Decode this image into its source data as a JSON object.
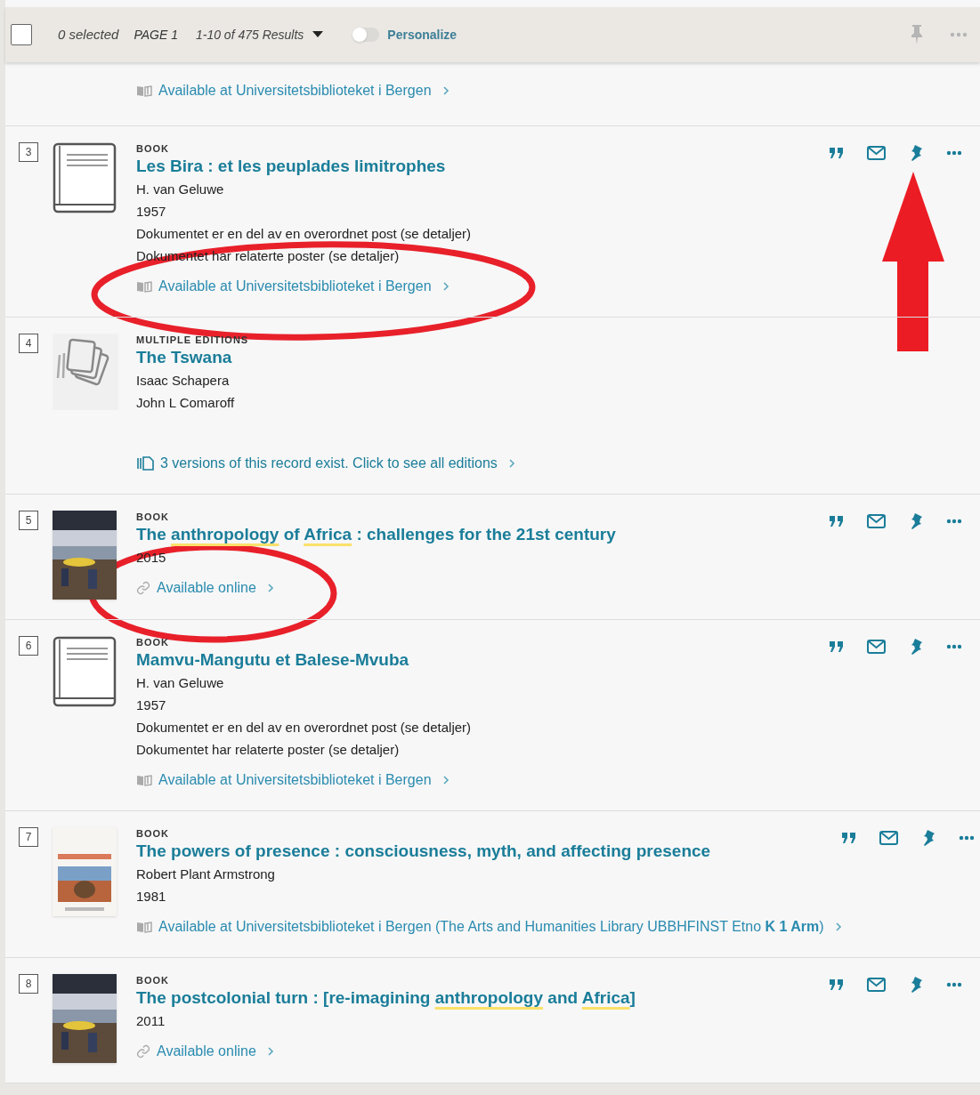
{
  "toolbar": {
    "select_all": {
      "checked": false
    },
    "selected_count": "0 selected",
    "page": "PAGE 1",
    "results": "1-10 of 475 Results",
    "personalize": {
      "label": "Personalize",
      "on": false
    }
  },
  "results": [
    {
      "kind": "partial",
      "availability": {
        "kind": "physical",
        "text": "Available at Universitetsbiblioteket i Bergen"
      }
    },
    {
      "kind": "record",
      "number": "3",
      "type": "BOOK",
      "thumbnail": {
        "kind": "book"
      },
      "actions": true,
      "title": [
        {
          "text": "Les Bira : et les peuplades limitrophes",
          "highlight": false
        }
      ],
      "lines": [
        "H. van Geluwe",
        "1957",
        "Dokumentet er en del av en overordnet post (se detaljer)",
        "Dokumentet har relaterte poster (se detaljer)"
      ],
      "availability": {
        "kind": "physical",
        "text": "Available at Universitetsbiblioteket i Bergen"
      }
    },
    {
      "kind": "record",
      "number": "4",
      "type": "MULTIPLE EDITIONS",
      "thumbnail": {
        "kind": "editions"
      },
      "actions": false,
      "title": [
        {
          "text": "The Tswana",
          "highlight": false
        }
      ],
      "lines": [
        "Isaac Schapera",
        "John L Comaroff"
      ],
      "availability": {
        "kind": "versions",
        "text": "3 versions of this record exist. Click to see all editions"
      }
    },
    {
      "kind": "record",
      "number": "5",
      "type": "BOOK",
      "thumbnail": {
        "kind": "picture"
      },
      "actions": true,
      "title": [
        {
          "text": "The ",
          "highlight": false
        },
        {
          "text": "anthropology",
          "highlight": true
        },
        {
          "text": " of ",
          "highlight": false
        },
        {
          "text": "Africa",
          "highlight": true
        },
        {
          "text": " : challenges for the 21st century",
          "highlight": false
        }
      ],
      "lines": [
        "2015"
      ],
      "availability": {
        "kind": "online",
        "text": "Available online"
      }
    },
    {
      "kind": "record",
      "number": "6",
      "type": "BOOK",
      "thumbnail": {
        "kind": "book"
      },
      "actions": true,
      "title": [
        {
          "text": "Mamvu-Mangutu et Balese-Mvuba",
          "highlight": false
        }
      ],
      "lines": [
        "H. van Geluwe",
        "1957",
        "Dokumentet er en del av en overordnet post (se detaljer)",
        "Dokumentet har relaterte poster (se detaljer)"
      ],
      "availability": {
        "kind": "physical",
        "text": "Available at Universitetsbiblioteket i Bergen"
      }
    },
    {
      "kind": "record",
      "number": "7",
      "type": "BOOK",
      "thumbnail": {
        "kind": "picture"
      },
      "actions": true,
      "title": [
        {
          "text": "The powers of presence : consciousness, myth, and affecting presence",
          "highlight": false
        }
      ],
      "lines": [
        "Robert Plant Armstrong",
        "1981"
      ],
      "availability": {
        "kind": "physical",
        "text": "Available at Universitetsbiblioteket i Bergen (The Arts and Humanities Library  UBBHFINST Etno **K 1 Arm**)"
      }
    },
    {
      "kind": "record",
      "number": "8",
      "type": "BOOK",
      "thumbnail": {
        "kind": "picture"
      },
      "actions": true,
      "title": [
        {
          "text": "The postcolonial turn : [re-imagining ",
          "highlight": false
        },
        {
          "text": "anthropology",
          "highlight": true
        },
        {
          "text": " and ",
          "highlight": false
        },
        {
          "text": "Africa",
          "highlight": true
        },
        {
          "text": "]",
          "highlight": false
        }
      ],
      "lines": [
        "2011"
      ],
      "availability": {
        "kind": "online",
        "text": "Available online"
      }
    }
  ]
}
